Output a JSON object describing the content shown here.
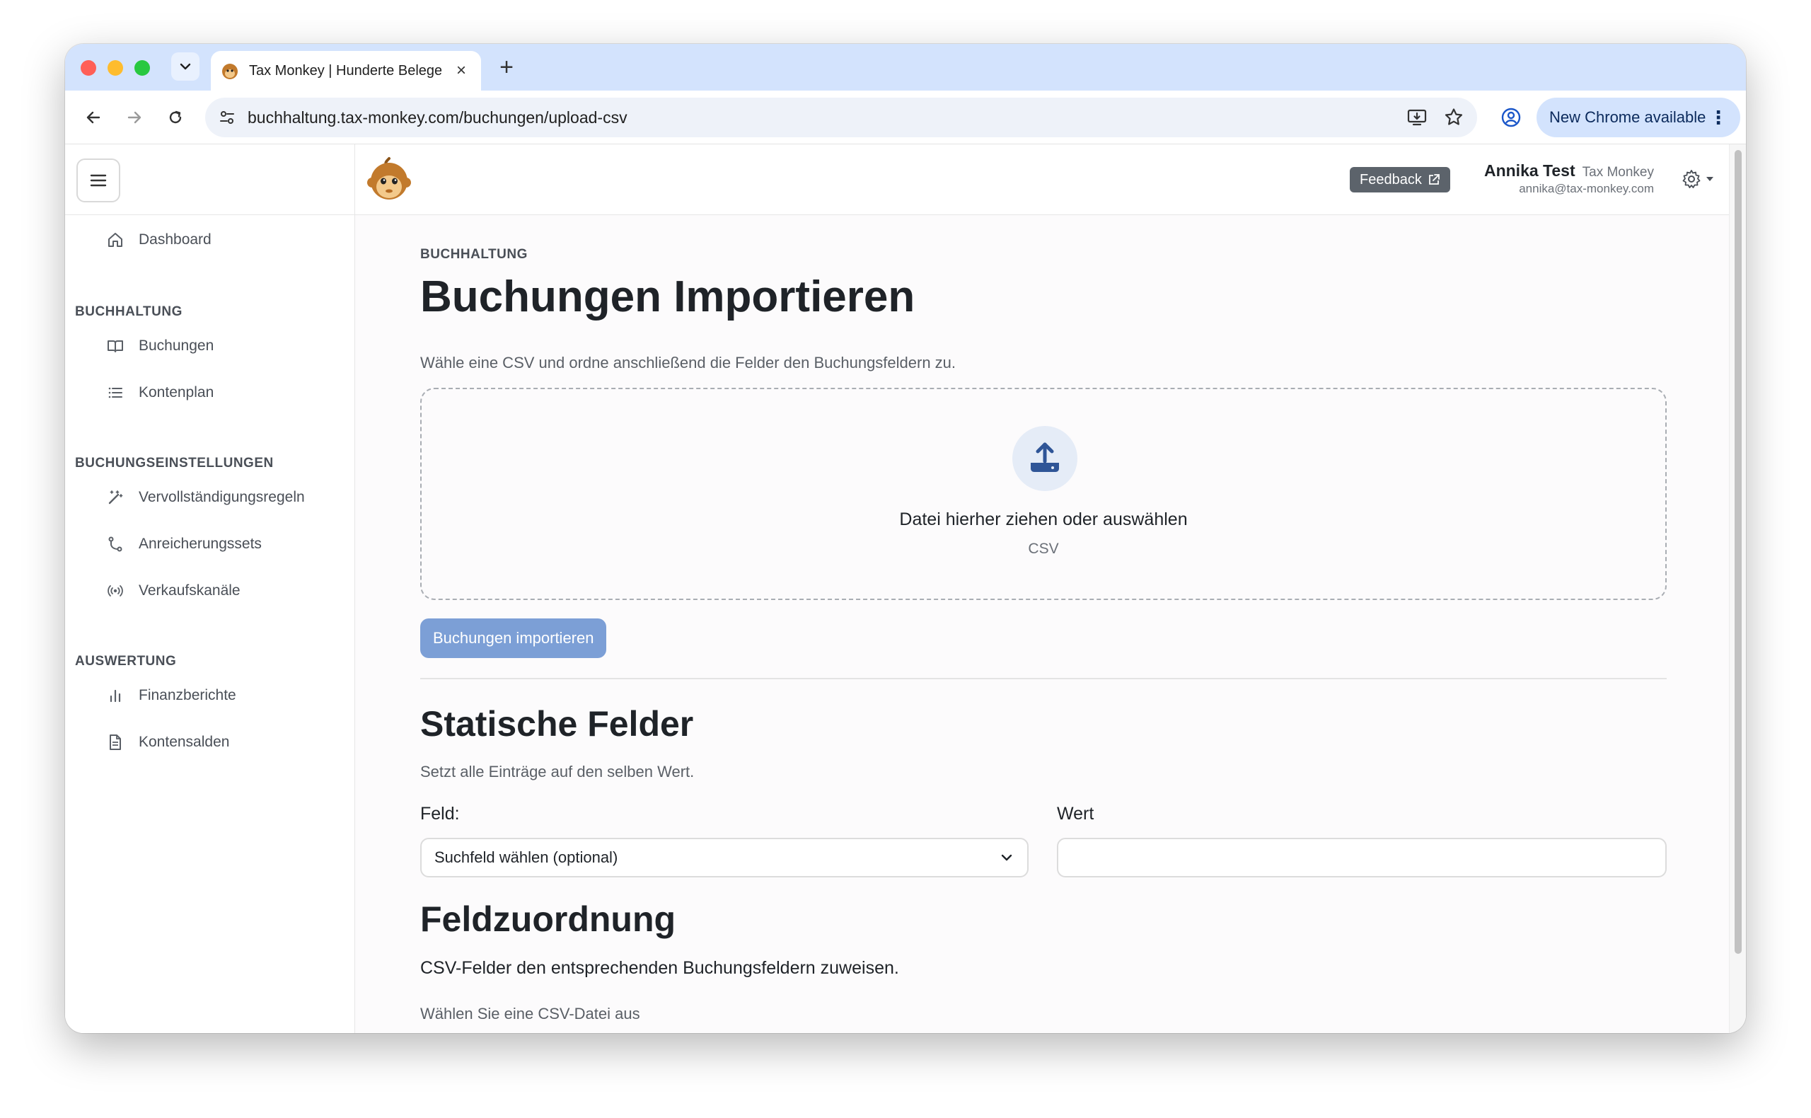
{
  "browser": {
    "tab_title": "Tax Monkey | Hunderte Belege",
    "url": "buchhaltung.tax-monkey.com/buchungen/upload-csv",
    "update_label": "New Chrome available",
    "new_tab_symbol": "+",
    "close_symbol": "×",
    "more_symbol": "⋮"
  },
  "header": {
    "feedback_label": "Feedback",
    "user_name": "Annika Test",
    "user_org": "Tax Monkey",
    "user_email": "annika@tax-monkey.com"
  },
  "sidebar": {
    "dashboard": "Dashboard",
    "sections": {
      "buchhaltung": "BUCHHALTUNG",
      "buchungseinstellungen": "BUCHUNGSEINSTELLUNGEN",
      "auswertung": "AUSWERTUNG"
    },
    "items": {
      "buchungen": "Buchungen",
      "kontenplan": "Kontenplan",
      "vervollstaendigungsregeln": "Vervollständigungsregeln",
      "anreicherungssets": "Anreicherungssets",
      "verkaufskanaele": "Verkaufskanäle",
      "finanzberichte": "Finanzberichte",
      "kontensalden": "Kontensalden"
    }
  },
  "main": {
    "eyebrow": "BUCHHALTUNG",
    "title": "Buchungen Importieren",
    "subtitle": "Wähle eine CSV und ordne anschließend die Felder den Buchungsfeldern zu.",
    "dropzone_text": "Datei hierher ziehen oder auswählen",
    "dropzone_sub": "CSV",
    "import_button": "Buchungen importieren",
    "static_fields": {
      "title": "Statische Felder",
      "description": "Setzt alle Einträge auf den selben Wert.",
      "field_label": "Feld:",
      "field_select_value": "Suchfeld wählen (optional)",
      "value_label": "Wert",
      "value_input": ""
    },
    "field_mapping": {
      "title": "Feldzuordnung",
      "description": "CSV-Felder den entsprechenden Buchungsfeldern zuweisen.",
      "hint": "Wählen Sie eine CSV-Datei aus"
    }
  },
  "colors": {
    "accent": "#7c9fd6",
    "upload_icon": "#2f5597",
    "chrome_tabstrip": "#d3e3fd"
  }
}
